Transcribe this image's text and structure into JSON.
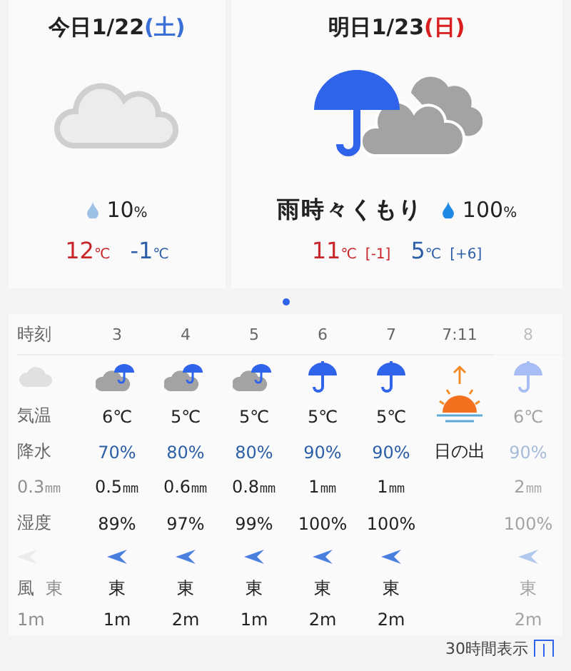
{
  "days": [
    {
      "date": "今日1/22",
      "weekday": "(土)",
      "color": "#3a6fd8",
      "kind": "cloud",
      "rain_chance": "10",
      "rain_unit": "%",
      "high": "12",
      "high_unit": "℃",
      "low": "-1",
      "low_unit": "℃"
    },
    {
      "date": "明日1/23",
      "weekday": "(日)",
      "color": "#d81e1e",
      "kind": "rain-cloud",
      "weather": "雨時々くもり",
      "rain_chance": "100",
      "rain_unit": "%",
      "high": "11",
      "high_unit": "℃",
      "high_diff": "[-1]",
      "low": "5",
      "low_unit": "℃",
      "low_diff": "[+6]"
    }
  ],
  "hourly": {
    "row_labels": [
      "時刻",
      "気温",
      "降水",
      "湿度",
      "風"
    ],
    "previous": {
      "amount": "0.3㎜",
      "wind_dir": "東",
      "wind_speed": "1m"
    },
    "hours": [
      {
        "time": "3",
        "kind": "cloud-rain",
        "temp": "6℃",
        "chance": "70%",
        "amount": "0.5㎜",
        "humidity": "89%",
        "wind_dir": "東",
        "wind_speed": "1m",
        "faded": false
      },
      {
        "time": "4",
        "kind": "cloud-rain",
        "temp": "5℃",
        "chance": "80%",
        "amount": "0.6㎜",
        "humidity": "97%",
        "wind_dir": "東",
        "wind_speed": "2m",
        "faded": false
      },
      {
        "time": "5",
        "kind": "cloud-rain",
        "temp": "5℃",
        "chance": "80%",
        "amount": "0.8㎜",
        "humidity": "99%",
        "wind_dir": "東",
        "wind_speed": "1m",
        "faded": false
      },
      {
        "time": "6",
        "kind": "umbrella",
        "temp": "5℃",
        "chance": "90%",
        "amount": "1㎜",
        "humidity": "100%",
        "wind_dir": "東",
        "wind_speed": "2m",
        "faded": false
      },
      {
        "time": "7",
        "kind": "umbrella",
        "temp": "5℃",
        "chance": "90%",
        "amount": "1㎜",
        "humidity": "100%",
        "wind_dir": "東",
        "wind_speed": "2m",
        "faded": false
      },
      {
        "time": "7:11",
        "kind": "sunrise",
        "event": "日の出",
        "faded": false
      },
      {
        "time": "8",
        "kind": "umbrella",
        "temp": "6℃",
        "chance": "90%",
        "amount": "2㎜",
        "humidity": "100%",
        "wind_dir": "東",
        "wind_speed": "2m",
        "faded": true
      }
    ]
  },
  "footer": {
    "label": "30時間表示"
  }
}
